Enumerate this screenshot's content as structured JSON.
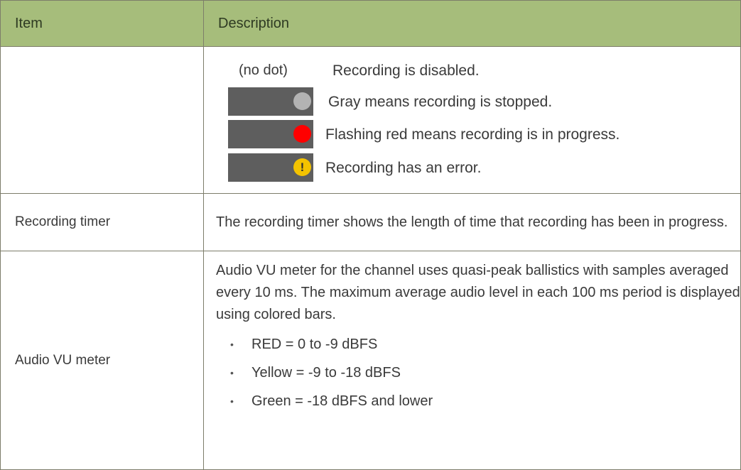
{
  "table": {
    "headers": {
      "item": "Item",
      "description": "Description"
    },
    "status_row": {
      "item": "",
      "indicators": [
        {
          "state": "none",
          "marker": "(no dot)",
          "text": "Recording is disabled.",
          "icon": ""
        },
        {
          "state": "stopped",
          "marker": "",
          "text": "Gray means recording is stopped.",
          "icon": "gray-dot-icon",
          "color": "#b3b3b3"
        },
        {
          "state": "recording",
          "marker": "",
          "text": "Flashing red means recording is in progress.",
          "icon": "red-dot-icon",
          "color": "#ff0000"
        },
        {
          "state": "error",
          "marker": "!",
          "text": "Recording has an error.",
          "icon": "warning-icon",
          "color": "#f4c300"
        }
      ]
    },
    "timer_row": {
      "item": "Recording timer",
      "description": "The recording timer shows the length of time that recording has been in progress."
    },
    "vu_row": {
      "item": "Audio VU meter",
      "description": "Audio VU meter for the channel uses quasi-peak ballistics with samples averaged every 10 ms. The maximum average audio level in each 100 ms period is displayed using colored bars.",
      "bullets": [
        "RED = 0 to -9 dBFS",
        "Yellow = -9 to -18 dBFS",
        "Green = -18 dBFS and lower"
      ]
    }
  },
  "colors": {
    "header_bg": "#a6bd7b",
    "indicator_bar": "#5e5e5e",
    "border": "#7d7d6a"
  }
}
